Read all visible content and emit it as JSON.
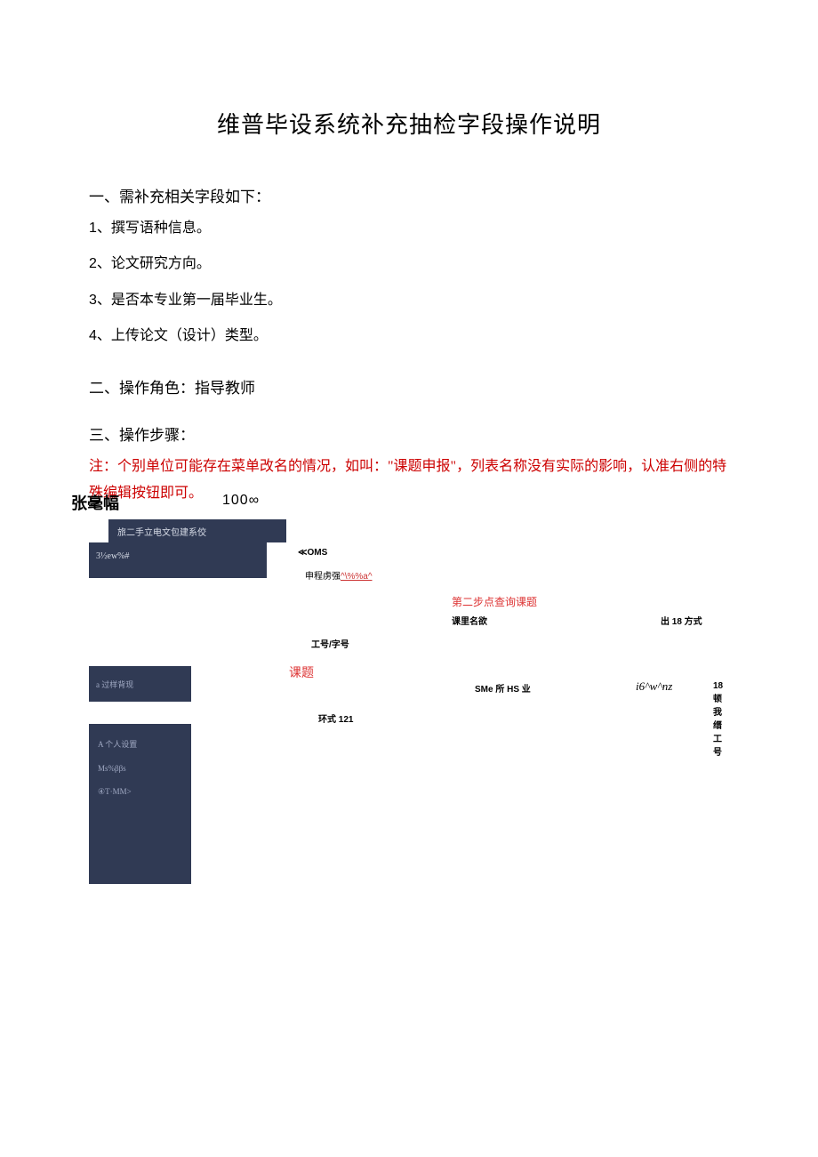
{
  "title": "维普毕设系统补充抽检字段操作说明",
  "section1": {
    "heading": "一、需补充相关字段如下：",
    "items": [
      {
        "num": "1",
        "text": "、撰写语种信息。"
      },
      {
        "num": "2",
        "text": "、论文研究方向。"
      },
      {
        "num": "3",
        "text": "、是否本专业第一届毕业生。"
      },
      {
        "num": "4",
        "text": "、上传论文（设计）类型。"
      }
    ]
  },
  "section2": {
    "heading": "二、操作角色：指导教师"
  },
  "section3": {
    "heading": "三、操作步骤：",
    "note": "注：个别单位可能存在菜单改名的情况，如叫：\"课题申报\"，列表名称没有实际的影响，认准右侧的特殊编辑按钮即可。"
  },
  "overlap": {
    "bold_name": "张毫幅",
    "percent": "100∞"
  },
  "mixed": {
    "db1": "旅二手立电文包建系佼",
    "db2": "3½ew%#",
    "db3": "a 过样背现",
    "db4_a": "A 个人设置",
    "db4_b": "Ms%ββs",
    "db4_c": "④T·MM>",
    "oms": "≪OMS",
    "linky_prefix": "申程虏强",
    "linky_red": "^\\%%a^",
    "redstep": "第二步点查询课题",
    "h_name": "课里名欲",
    "h_mode": "出 18 方式",
    "h_id": "工号/字号",
    "redketi": "课题",
    "sme": "SMe 所 HS 业",
    "italic": "i6^w^nz",
    "tailnum": "18 顿我缙工号",
    "huanshi": "环式 121"
  }
}
